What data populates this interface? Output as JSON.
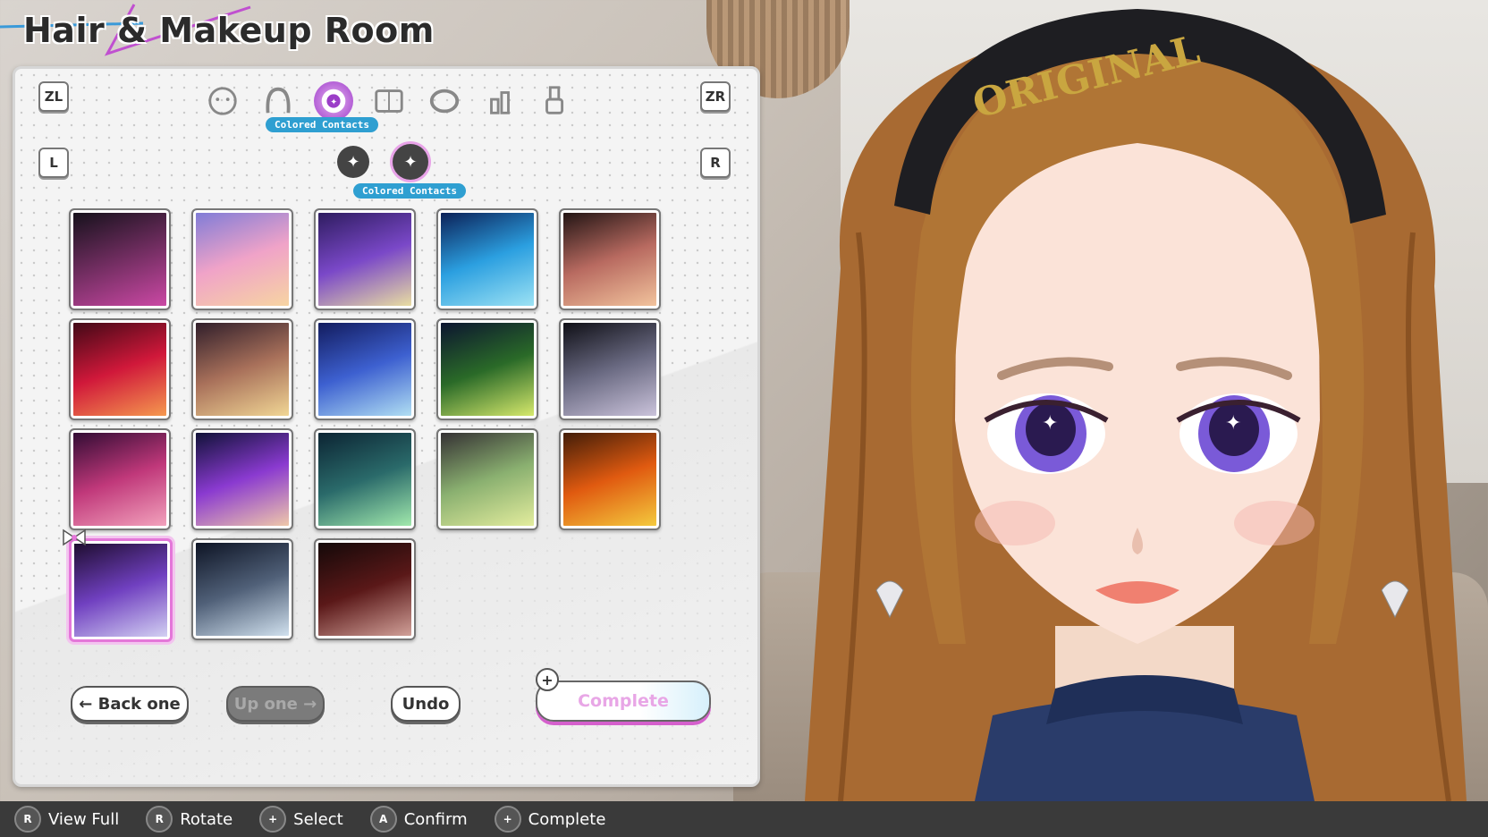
{
  "title": "Hair & Makeup Room",
  "top_keys": {
    "left": "ZL",
    "right": "ZR"
  },
  "sub_keys": {
    "left": "L",
    "right": "R"
  },
  "categories": [
    {
      "name": "face-icon"
    },
    {
      "name": "hair-icon"
    },
    {
      "name": "eye-icon",
      "active": true,
      "label": "Colored Contacts"
    },
    {
      "name": "palette-icon"
    },
    {
      "name": "ring-icon"
    },
    {
      "name": "lipstick-icon"
    },
    {
      "name": "nail-polish-icon"
    }
  ],
  "subcategories": [
    {
      "name": "sparkle-eye-icon"
    },
    {
      "name": "colored-contacts-icon",
      "active": true,
      "label": "Colored Contacts"
    }
  ],
  "swatches": [
    [
      "#111018",
      "#d04aa8"
    ],
    [
      "#7a7ad8",
      "#f0a3c8",
      "#f7d7a0"
    ],
    [
      "#2a1a5a",
      "#7a48c8",
      "#efe6a0"
    ],
    [
      "#0a1a50",
      "#2b9fe0",
      "#a3e6f5"
    ],
    [
      "#1a1010",
      "#b86a60",
      "#f5c8a0"
    ],
    [
      "#3a0814",
      "#d0183a",
      "#f7a050"
    ],
    [
      "#2a1a28",
      "#a8705a",
      "#f5dc98"
    ],
    [
      "#101858",
      "#3d60d0",
      "#b7e6f5"
    ],
    [
      "#0a1030",
      "#2a6a28",
      "#e0f070"
    ],
    [
      "#0a0a10",
      "#6a6a82",
      "#d0c8e0"
    ],
    [
      "#2a0a30",
      "#c0387a",
      "#f5a8c0"
    ],
    [
      "#0a1030",
      "#8a3ad0",
      "#f5d0a8"
    ],
    [
      "#0a2030",
      "#2a6a6a",
      "#a8f0b0"
    ],
    [
      "#302a30",
      "#8ab070",
      "#e8f0a0"
    ],
    [
      "#3a1a08",
      "#e05a10",
      "#f5d040"
    ],
    [
      "#1a0a28",
      "#7040c0",
      "#d8d8f5"
    ],
    [
      "#0a1020",
      "#506078",
      "#d8e8f5"
    ],
    [
      "#100808",
      "#5a1818",
      "#d8a8a0"
    ]
  ],
  "selected_index": 15,
  "buttons": {
    "back": "Back one",
    "up": "Up one",
    "undo": "Undo",
    "complete": "Complete"
  },
  "footer": [
    {
      "icon": "R",
      "label": "View Full"
    },
    {
      "icon": "R",
      "label": "Rotate"
    },
    {
      "icon": "+",
      "label": "Select"
    },
    {
      "icon": "A",
      "label": "Confirm"
    },
    {
      "icon": "+",
      "label": "Complete"
    }
  ],
  "headband_text": "ORIGINAL",
  "colors": {
    "accent": "#e477d9",
    "tag": "#2f9fd1",
    "hair": "#a86a32",
    "iris": "#7a5ad8"
  }
}
